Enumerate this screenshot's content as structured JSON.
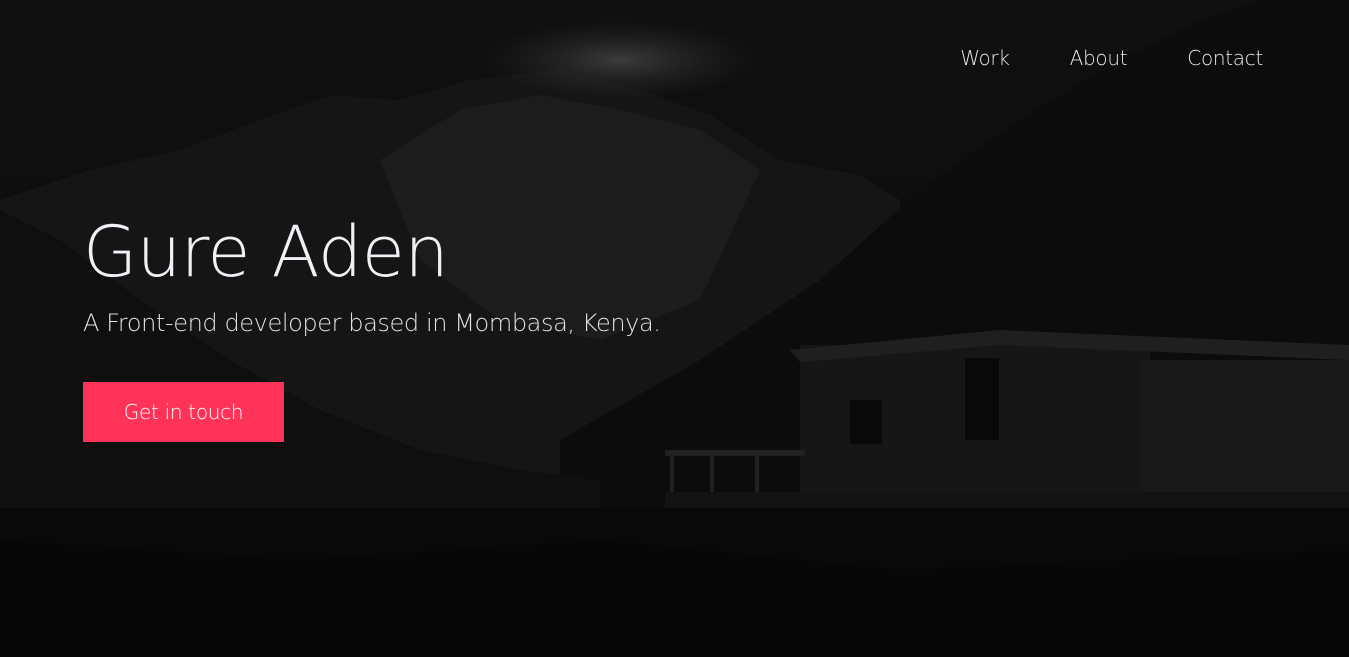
{
  "nav": {
    "items": [
      {
        "label": "Work"
      },
      {
        "label": "About"
      },
      {
        "label": "Contact"
      }
    ]
  },
  "hero": {
    "title": "Gure Aden",
    "subtitle": "A Front-end developer based in Mombasa, Kenya.",
    "cta_label": "Get in touch"
  },
  "colors": {
    "accent": "#ff3358",
    "background": "#0a0a0a",
    "text": "#f4eef6"
  }
}
